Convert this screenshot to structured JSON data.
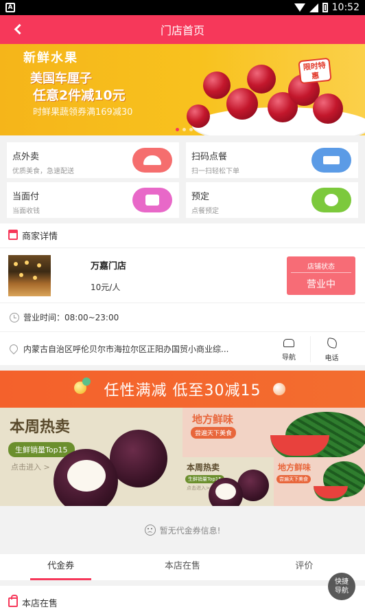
{
  "status_bar": {
    "carrier_icon": "A",
    "time": "10:52"
  },
  "navbar": {
    "title": "门店首页",
    "back_icon": "chevron-left-icon"
  },
  "banner": {
    "tag": "新鲜水果",
    "headline_1": "美国车厘子",
    "headline_2": "任意2件减10元",
    "subline": "时鲜果蔬领券满169减30",
    "badge": "限时特惠",
    "slide_count": 3,
    "active_slide": 1
  },
  "quick_actions": [
    {
      "title": "点外卖",
      "subtitle": "优质美食，急速配送",
      "color": "#f56e6e",
      "icon": "dish-cover-icon"
    },
    {
      "title": "扫码点餐",
      "subtitle": "扫一扫轻松下单",
      "color": "#5b9be6",
      "icon": "cart-icon"
    },
    {
      "title": "当面付",
      "subtitle": "当面收钱",
      "color": "#e868c8",
      "icon": "wallet-icon"
    },
    {
      "title": "预定",
      "subtitle": "点餐预定",
      "color": "#7cc93c",
      "icon": "fruit-icon"
    }
  ],
  "merchant": {
    "section_title": "商家详情",
    "name": "万嘉门店",
    "price": "10元/人",
    "status_label": "店铺状态",
    "status_value": "营业中",
    "hours": "营业时间：08:00~23:00",
    "address": "内蒙古自治区呼伦贝尔市海拉尔区正阳办国贸小商业综...",
    "nav_label": "导航",
    "phone_label": "电话"
  },
  "promo": {
    "text": "任性满减  低至30减15"
  },
  "feature": {
    "left_title": "本周热卖",
    "left_pill": "生鲜销量Top15",
    "left_enter": "点击进入 >",
    "right_top_title": "地方鲜味",
    "right_top_sub": "尝遍天下美食",
    "rb1_title": "本周热卖",
    "rb1_pill": "生鲜销量Top15",
    "rb1_enter": "点击进入>",
    "rb2_title": "地方鲜味",
    "rb2_sub": "尝遍天下美食"
  },
  "coupons": {
    "empty_text": "暂无代金券信息!"
  },
  "tabs": [
    {
      "label": "代金券",
      "active": true
    },
    {
      "label": "本店在售",
      "active": false
    },
    {
      "label": "评价",
      "active": false
    }
  ],
  "on_sale": {
    "title": "本店在售"
  },
  "fab": {
    "line1": "快捷",
    "line2": "导航"
  }
}
